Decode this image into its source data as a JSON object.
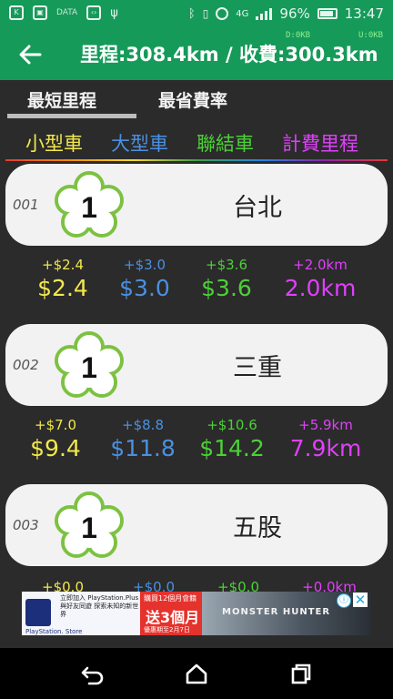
{
  "status_bar": {
    "data_label": "DATA",
    "network": "4G",
    "battery": "96%",
    "time": "13:47"
  },
  "app_bar": {
    "title": "里程:308.4km / 收費:300.3km",
    "download": "D:0KB",
    "upload": "U:0KB"
  },
  "tabs": [
    {
      "label": "最短里程",
      "active": true
    },
    {
      "label": "最省費率",
      "active": false
    }
  ],
  "legend": [
    {
      "label": "小型車",
      "color": "#f2e84b"
    },
    {
      "label": "大型車",
      "color": "#4a90e2"
    },
    {
      "label": "聯結車",
      "color": "#4cd137"
    },
    {
      "label": "計費里程",
      "color": "#e040fb"
    }
  ],
  "stations": [
    {
      "index": "001",
      "badge": "1",
      "name": "台北",
      "fees": {
        "small": {
          "delta": "+$2.4",
          "total": "$2.4"
        },
        "large": {
          "delta": "+$3.0",
          "total": "$3.0"
        },
        "trailer": {
          "delta": "+$3.6",
          "total": "$3.6"
        },
        "km": {
          "delta": "+2.0km",
          "total": "2.0km"
        }
      }
    },
    {
      "index": "002",
      "badge": "1",
      "name": "三重",
      "fees": {
        "small": {
          "delta": "+$7.0",
          "total": "$9.4"
        },
        "large": {
          "delta": "+$8.8",
          "total": "$11.8"
        },
        "trailer": {
          "delta": "+$10.6",
          "total": "$14.2"
        },
        "km": {
          "delta": "+5.9km",
          "total": "7.9km"
        }
      }
    },
    {
      "index": "003",
      "badge": "1",
      "name": "五股",
      "fees": {
        "small": {
          "delta": "+$0.0"
        },
        "large": {
          "delta": "+$0.0"
        },
        "trailer": {
          "delta": "+$0.0"
        },
        "km": {
          "delta": "+0.0km"
        }
      }
    }
  ],
  "ad": {
    "store_label": "PlayStation. Store",
    "copy": "立即加入 PlayStation.Plus 與好友同遊 探索未知的新世界",
    "promo_top": "購買12個月會籍",
    "promo_big": "送3個月",
    "promo_bottom": "優惠期至2月7日",
    "game": "MONSTER HUNTER",
    "info_icon": "ⓘ",
    "close_icon": "✕"
  },
  "nav_bar": {
    "icons": [
      "back-nav-icon",
      "home-nav-icon",
      "recents-nav-icon"
    ]
  }
}
